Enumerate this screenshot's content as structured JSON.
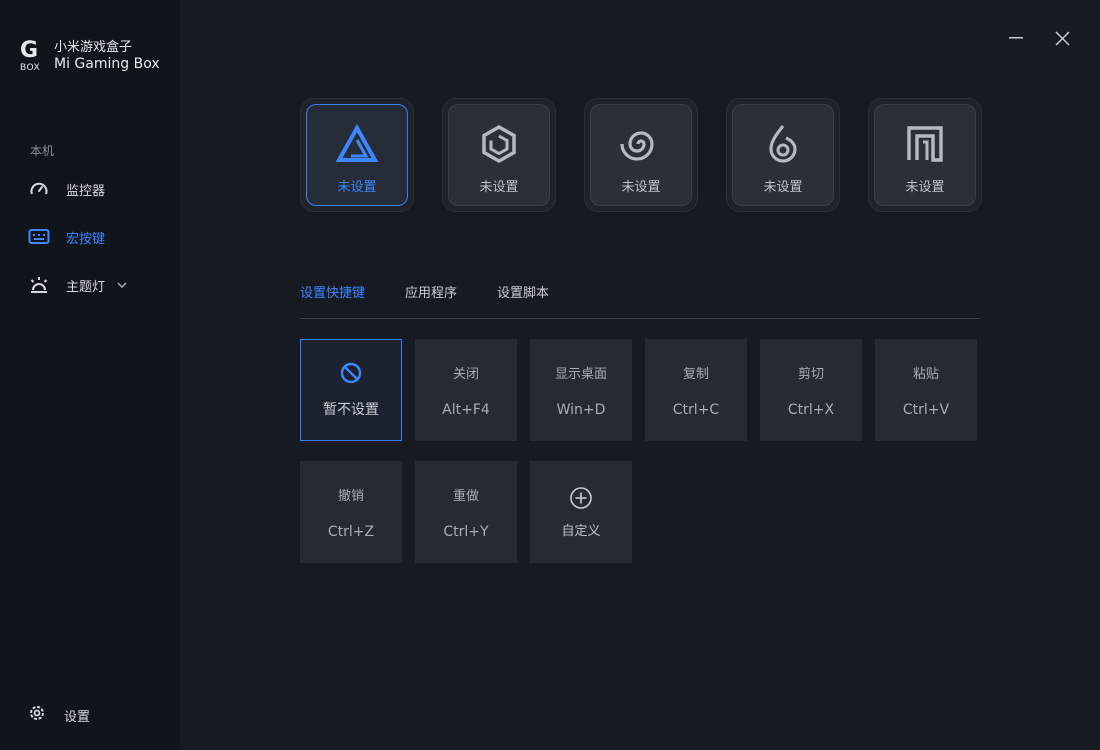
{
  "app": {
    "logo_mark": "G",
    "logo_box": "BOX",
    "title_cn": "小米游戏盒子",
    "title_en": "Mi Gaming Box"
  },
  "sidebar": {
    "section": "本机",
    "items": [
      {
        "label": "监控器",
        "icon": "speedometer-icon"
      },
      {
        "label": "宏按键",
        "icon": "keyboard-icon",
        "active": true
      },
      {
        "label": "主题灯",
        "icon": "light-icon"
      }
    ],
    "settings_label": "设置"
  },
  "slots": [
    {
      "label": "未设置",
      "icon": "triangle-logo-icon",
      "active": true
    },
    {
      "label": "未设置",
      "icon": "hexagon-logo-icon"
    },
    {
      "label": "未设置",
      "icon": "spiral-logo-icon"
    },
    {
      "label": "未设置",
      "icon": "flame-logo-icon"
    },
    {
      "label": "未设置",
      "icon": "square-spiral-logo-icon"
    }
  ],
  "tabs": [
    {
      "label": "设置快捷键",
      "active": true
    },
    {
      "label": "应用程序"
    },
    {
      "label": "设置脚本"
    }
  ],
  "keys": [
    {
      "name": "暂不设置",
      "icon": "ban-icon",
      "active": true
    },
    {
      "name": "关闭",
      "combo": "Alt+F4"
    },
    {
      "name": "显示桌面",
      "combo": "Win+D"
    },
    {
      "name": "复制",
      "combo": "Ctrl+C"
    },
    {
      "name": "剪切",
      "combo": "Ctrl+X"
    },
    {
      "name": "粘贴",
      "combo": "Ctrl+V"
    },
    {
      "name": "撤销",
      "combo": "Ctrl+Z"
    },
    {
      "name": "重做",
      "combo": "Ctrl+Y"
    },
    {
      "name": "自定义",
      "icon": "plus-circle-icon"
    }
  ],
  "colors": {
    "accent": "#3d86ff",
    "background": "#151a23",
    "sidebar": "#10141b",
    "key_bg": "#262b33"
  }
}
